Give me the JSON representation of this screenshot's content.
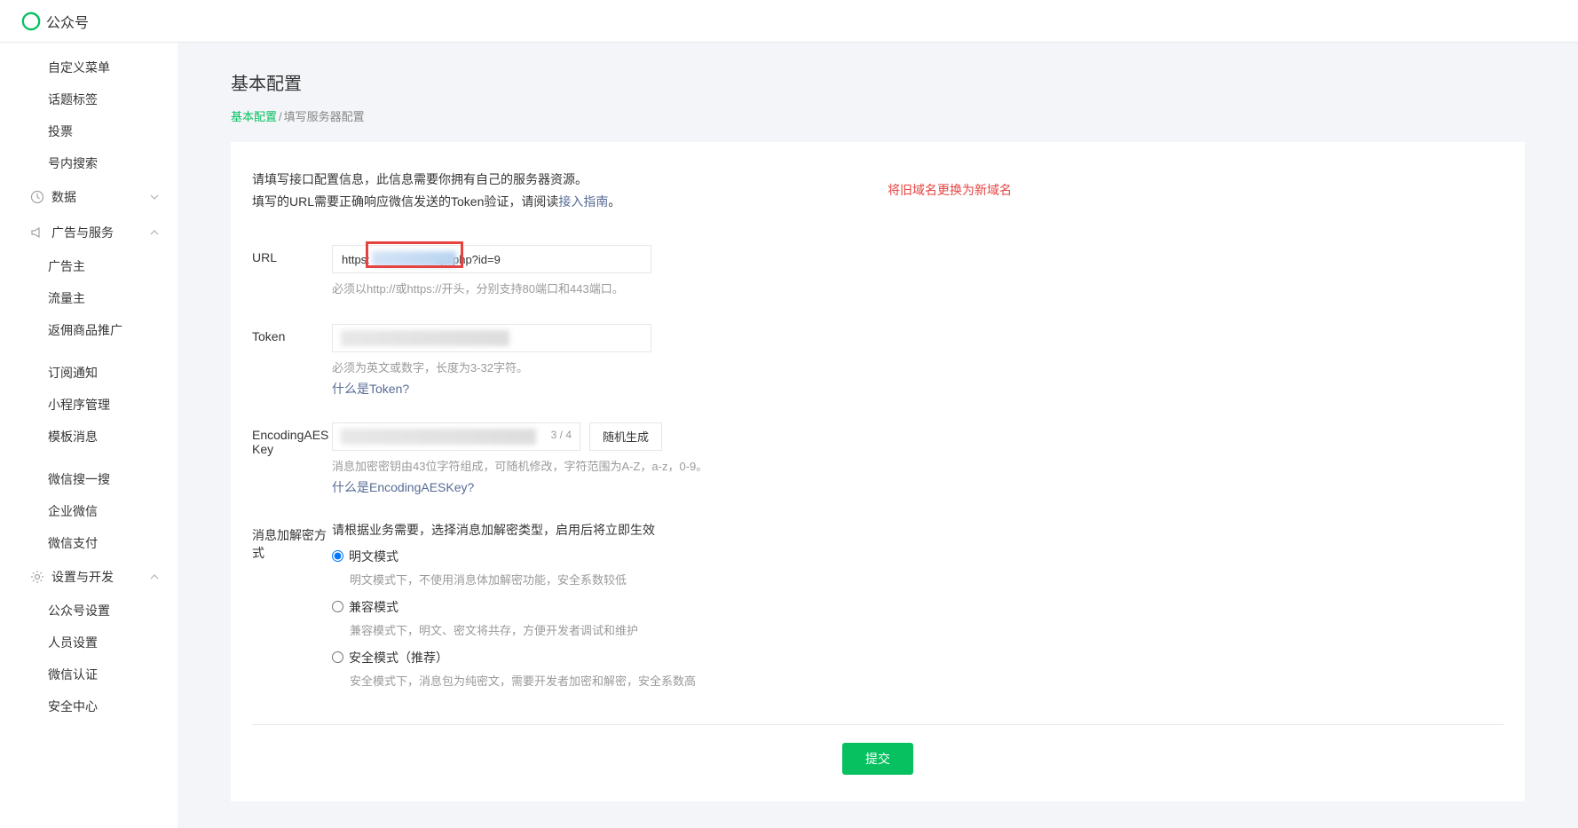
{
  "header": {
    "brand": "公众号"
  },
  "sidebar": {
    "items_top": [
      "自定义菜单",
      "话题标签",
      "投票",
      "号内搜索"
    ],
    "group_data": "数据",
    "group_ads": "广告与服务",
    "items_ads": [
      "广告主",
      "流量主",
      "返佣商品推广"
    ],
    "items_mid": [
      "订阅通知",
      "小程序管理",
      "模板消息"
    ],
    "items_wx": [
      "微信搜一搜",
      "企业微信",
      "微信支付"
    ],
    "group_settings": "设置与开发",
    "items_settings": [
      "公众号设置",
      "人员设置",
      "微信认证",
      "安全中心"
    ]
  },
  "page": {
    "title": "基本配置",
    "breadcrumb_link": "基本配置",
    "breadcrumb_current": "填写服务器配置",
    "intro1": "请填写接口配置信息，此信息需要你拥有自己的服务器资源。",
    "intro2_pre": "填写的URL需要正确响应微信发送的Token验证，请阅读",
    "intro2_link": "接入指南",
    "intro2_post": "。",
    "annotation": "将旧域名更换为新域名"
  },
  "form": {
    "url_label": "URL",
    "url_value_pre": "https:",
    "url_value_post": "api.php?id=9",
    "url_hint": "必须以http://或https://开头，分别支持80端口和443端口。",
    "token_label": "Token",
    "token_hint": "必须为英文或数字，长度为3-32字符。",
    "token_link": "什么是Token?",
    "aes_label": "EncodingAESKey",
    "aes_counter": "3 / 4",
    "aes_gen": "随机生成",
    "aes_hint": "消息加密密钥由43位字符组成，可随机修改，字符范围为A-Z，a-z，0-9。",
    "aes_link": "什么是EncodingAESKey?",
    "mode_label": "消息加解密方式",
    "mode_intro": "请根据业务需要，选择消息加解密类型，启用后将立即生效",
    "modes": [
      {
        "label": "明文模式",
        "desc": "明文模式下，不使用消息体加解密功能，安全系数较低"
      },
      {
        "label": "兼容模式",
        "desc": "兼容模式下，明文、密文将共存，方便开发者调试和维护"
      },
      {
        "label": "安全模式（推荐）",
        "desc": "安全模式下，消息包为纯密文，需要开发者加密和解密，安全系数高"
      }
    ],
    "submit": "提交"
  }
}
